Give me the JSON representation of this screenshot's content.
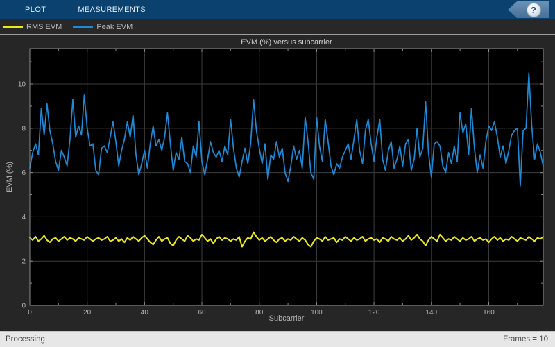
{
  "toolbar": {
    "tabs": [
      {
        "label": "PLOT"
      },
      {
        "label": "MEASUREMENTS"
      }
    ],
    "help_label": "?"
  },
  "legend": {
    "items": [
      {
        "label": "RMS EVM",
        "color": "#ecec13"
      },
      {
        "label": "Peak EVM",
        "color": "#1e8bd9"
      }
    ]
  },
  "status_bar": {
    "left": "Processing",
    "right": "Frames = 10"
  },
  "chart_data": {
    "type": "line",
    "title": "EVM (%) versus subcarrier",
    "xlabel": "Subcarrier",
    "ylabel": "EVM (%)",
    "xlim": [
      0,
      179
    ],
    "ylim": [
      0,
      11.6
    ],
    "x_ticks": [
      0,
      20,
      40,
      60,
      80,
      100,
      120,
      140,
      160
    ],
    "y_ticks": [
      0,
      2,
      4,
      6,
      8,
      10
    ],
    "x_minor_step": 10,
    "y_minor_step": 1,
    "grid": true,
    "legend_position": "top-strip",
    "plot_background": "#000000",
    "grid_color": "#3d3d3d",
    "axis_color": "#8c8c8c",
    "tick_label_color": "#b5b5b5",
    "series": [
      {
        "name": "RMS EVM",
        "color": "#ecec13",
        "values": [
          3.05,
          2.95,
          3.1,
          2.9,
          3.0,
          3.15,
          2.95,
          2.85,
          3.0,
          3.05,
          2.9,
          3.0,
          3.1,
          2.95,
          3.05,
          3.0,
          2.9,
          3.05,
          3.0,
          2.95,
          3.1,
          3.0,
          2.9,
          3.0,
          3.05,
          2.95,
          3.0,
          3.1,
          2.9,
          2.95,
          3.05,
          2.9,
          3.0,
          2.85,
          3.05,
          2.95,
          3.1,
          3.0,
          2.9,
          3.05,
          3.15,
          3.0,
          2.85,
          2.75,
          2.95,
          3.1,
          2.9,
          3.0,
          3.05,
          2.8,
          2.7,
          2.95,
          3.1,
          3.0,
          2.9,
          3.15,
          3.05,
          2.9,
          3.0,
          2.95,
          3.2,
          3.05,
          2.9,
          3.0,
          2.8,
          3.0,
          3.1,
          2.95,
          3.05,
          3.0,
          2.9,
          3.0,
          2.95,
          3.1,
          2.65,
          2.9,
          3.05,
          3.0,
          3.3,
          3.1,
          2.95,
          3.05,
          2.9,
          3.0,
          3.1,
          2.95,
          2.85,
          3.0,
          3.05,
          2.9,
          3.0,
          2.95,
          3.1,
          3.0,
          2.9,
          3.05,
          2.95,
          2.75,
          2.65,
          2.9,
          3.05,
          3.0,
          2.9,
          3.1,
          2.95,
          3.0,
          3.05,
          2.85,
          3.0,
          2.95,
          3.1,
          3.0,
          2.9,
          3.05,
          2.95,
          3.0,
          3.1,
          2.9,
          3.0,
          3.05,
          2.95,
          3.0,
          2.85,
          3.05,
          3.0,
          2.9,
          3.1,
          3.0,
          2.95,
          3.05,
          2.9,
          3.0,
          3.15,
          2.95,
          3.05,
          3.2,
          3.0,
          2.9,
          2.7,
          2.95,
          3.1,
          3.0,
          2.9,
          3.2,
          3.05,
          2.9,
          3.0,
          2.95,
          3.1,
          3.0,
          2.9,
          3.05,
          2.95,
          3.0,
          3.1,
          2.9,
          3.0,
          3.05,
          2.95,
          3.0,
          2.85,
          3.0,
          3.1,
          2.95,
          3.05,
          2.9,
          3.0,
          2.95,
          3.1,
          3.0,
          2.9,
          3.05,
          3.0,
          2.95,
          3.1,
          3.0,
          2.9,
          3.05,
          3.0,
          3.1
        ]
      },
      {
        "name": "Peak EVM",
        "color": "#1e8bd9",
        "values": [
          6.2,
          6.9,
          7.3,
          6.8,
          8.9,
          7.7,
          9.1,
          7.9,
          7.3,
          6.5,
          6.1,
          7.0,
          6.7,
          6.3,
          7.5,
          9.3,
          7.6,
          8.1,
          7.7,
          9.5,
          8.0,
          7.2,
          7.3,
          6.1,
          5.9,
          7.1,
          7.2,
          6.9,
          7.6,
          8.3,
          7.4,
          6.3,
          7.0,
          7.5,
          8.3,
          7.6,
          8.6,
          6.8,
          5.9,
          6.4,
          7.0,
          6.2,
          7.3,
          8.1,
          7.2,
          7.5,
          7.0,
          7.6,
          8.7,
          7.3,
          6.1,
          6.9,
          6.6,
          7.6,
          6.5,
          6.4,
          6.0,
          7.2,
          6.7,
          8.3,
          6.5,
          5.9,
          6.6,
          7.4,
          6.9,
          6.7,
          7.0,
          6.5,
          7.2,
          6.8,
          8.4,
          7.1,
          6.2,
          5.8,
          6.5,
          7.1,
          6.4,
          7.3,
          9.3,
          7.9,
          7.1,
          6.4,
          7.3,
          5.7,
          6.8,
          6.6,
          7.4,
          6.7,
          7.1,
          6.0,
          5.6,
          6.3,
          7.2,
          6.6,
          7.0,
          6.2,
          8.5,
          7.4,
          6.0,
          5.7,
          8.5,
          7.2,
          6.5,
          8.4,
          7.4,
          6.3,
          5.9,
          6.4,
          6.2,
          6.7,
          7.0,
          7.3,
          6.6,
          7.5,
          8.4,
          7.0,
          6.4,
          7.9,
          8.4,
          7.3,
          6.5,
          7.6,
          8.4,
          6.6,
          6.1,
          7.0,
          7.4,
          6.2,
          6.6,
          7.2,
          6.3,
          7.3,
          7.5,
          6.1,
          6.6,
          8.0,
          6.7,
          7.1,
          9.2,
          6.9,
          5.8,
          7.3,
          7.4,
          7.2,
          6.3,
          6.0,
          6.9,
          6.4,
          7.2,
          6.5,
          8.7,
          7.8,
          8.2,
          6.8,
          8.9,
          7.1,
          6.0,
          6.8,
          6.2,
          7.4,
          8.1,
          7.9,
          8.3,
          7.6,
          6.7,
          7.2,
          6.4,
          7.0,
          7.7,
          7.9,
          8.0,
          5.4,
          7.9,
          8.0,
          10.5,
          8.1,
          6.6,
          7.3,
          6.9,
          6.3
        ]
      }
    ]
  }
}
